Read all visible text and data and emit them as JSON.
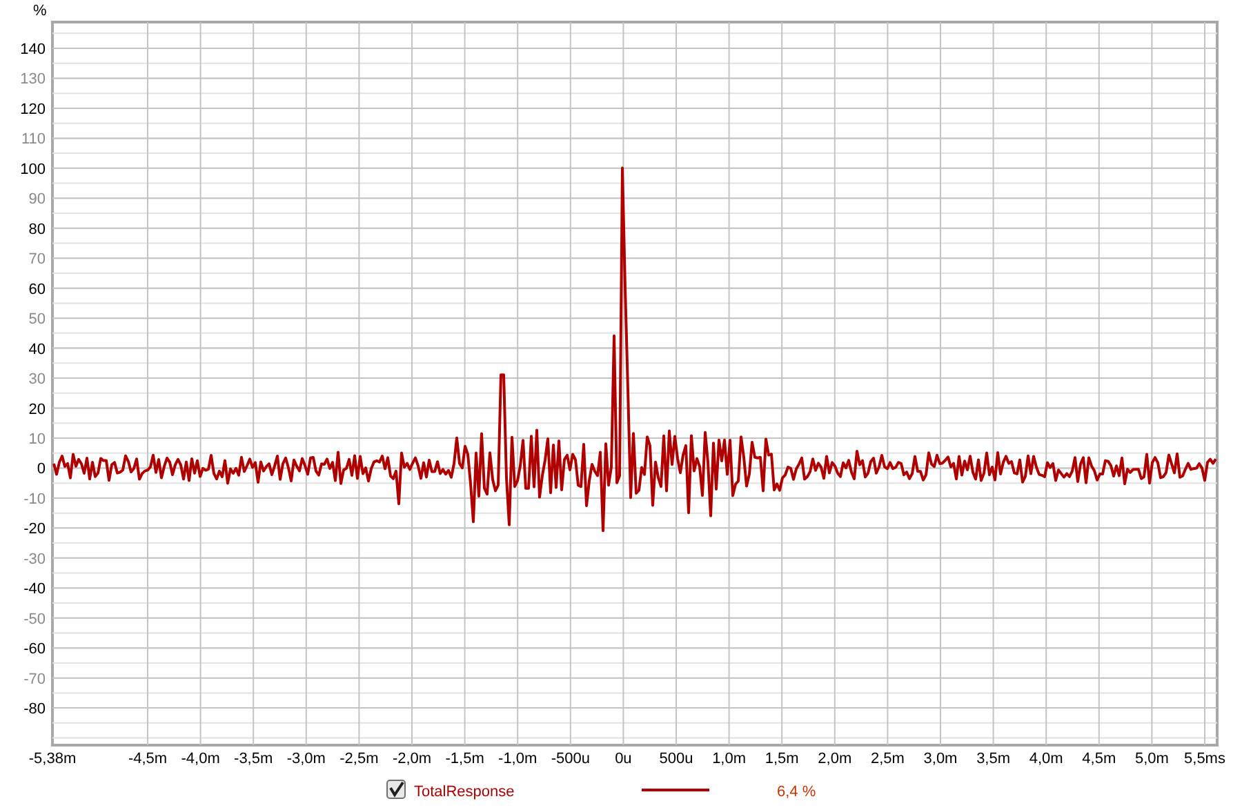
{
  "chart": {
    "y_unit": "%",
    "y_tick_labels": [
      {
        "label": "140",
        "dark": true
      },
      {
        "label": "130",
        "dark": false
      },
      {
        "label": "120",
        "dark": true
      },
      {
        "label": "110",
        "dark": false
      },
      {
        "label": "100",
        "dark": true
      },
      {
        "label": "90",
        "dark": false
      },
      {
        "label": "80",
        "dark": true
      },
      {
        "label": "70",
        "dark": false
      },
      {
        "label": "60",
        "dark": true
      },
      {
        "label": "50",
        "dark": false
      },
      {
        "label": "40",
        "dark": true
      },
      {
        "label": "30",
        "dark": false
      },
      {
        "label": "20",
        "dark": true
      },
      {
        "label": "10",
        "dark": false
      },
      {
        "label": "0",
        "dark": true
      },
      {
        "label": "-10",
        "dark": false
      },
      {
        "label": "-20",
        "dark": true
      },
      {
        "label": "-30",
        "dark": false
      },
      {
        "label": "-40",
        "dark": true
      },
      {
        "label": "-50",
        "dark": false
      },
      {
        "label": "-60",
        "dark": true
      },
      {
        "label": "-70",
        "dark": false
      },
      {
        "label": "-80",
        "dark": true
      }
    ],
    "x_tick_labels": [
      "-5,38m",
      "-4,5m",
      "-4,0m",
      "-3,5m",
      "-3,0m",
      "-2,5m",
      "-2,0m",
      "-1,5m",
      "-1,0m",
      "-500u",
      "0u",
      "500u",
      "1,0m",
      "1,5m",
      "2,0m",
      "2,5m",
      "3,0m",
      "3,5m",
      "4,0m",
      "4,5m",
      "5,0m",
      "5,5ms"
    ]
  },
  "legend": {
    "checked": true,
    "name": "TotalResponse",
    "color": "#b00000",
    "value": "6,4 %"
  }
}
